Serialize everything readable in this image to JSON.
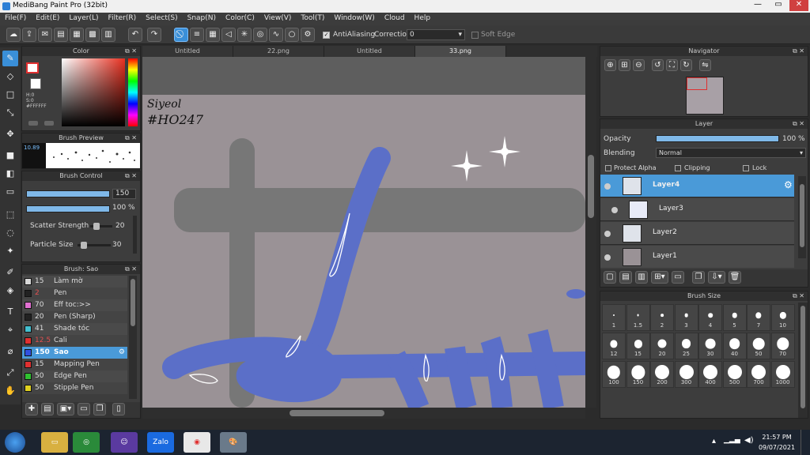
{
  "window": {
    "title": "MediBang Paint Pro (32bit)",
    "min": "—",
    "max": "▭",
    "close": "✕"
  },
  "menu": [
    "File(F)",
    "Edit(E)",
    "Layer(L)",
    "Filter(R)",
    "Select(S)",
    "Snap(N)",
    "Color(C)",
    "View(V)",
    "Tool(T)",
    "Window(W)",
    "Cloud",
    "Help"
  ],
  "toolbar": {
    "antialias_label": "AntiAliasing",
    "correction_label": "Correction",
    "correction_value": "0",
    "soft_edge_label": "Soft Edge"
  },
  "tabs": [
    "Untitled",
    "22.png",
    "Untitled",
    "33.png"
  ],
  "color_panel": {
    "title": "Color",
    "h": "H:0",
    "s": "S:0",
    "hex": "#FFFFFF"
  },
  "brush_preview": {
    "title": "Brush Preview",
    "size": "10.89"
  },
  "brush_control": {
    "title": "Brush Control",
    "size_value": "150",
    "opacity_value": "100 %",
    "scatter_label": "Scatter Strength",
    "scatter_value": "20",
    "particle_label": "Particle Size",
    "particle_value": "30"
  },
  "brush_list": {
    "title": "Brush: Sao",
    "items": [
      {
        "num": "15",
        "name": "Làm mờ",
        "color": "#d8d8d8"
      },
      {
        "num": "2",
        "name": "Pen",
        "color": "#222222"
      },
      {
        "num": "70",
        "name": "Eff toc:>>",
        "color": "#e070d0"
      },
      {
        "num": "20",
        "name": "Pen (Sharp)",
        "color": "#222222"
      },
      {
        "num": "41",
        "name": "Shade tóc",
        "color": "#44c0d0"
      },
      {
        "num": "12.5",
        "name": "Cali",
        "color": "#e03030"
      },
      {
        "num": "150",
        "name": "Sao",
        "color": "#3050e0",
        "selected": true
      },
      {
        "num": "15",
        "name": "Mapping Pen",
        "color": "#e03030"
      },
      {
        "num": "50",
        "name": "Edge Pen",
        "color": "#30c030"
      },
      {
        "num": "50",
        "name": "Stipple Pen",
        "color": "#e0d020"
      }
    ]
  },
  "canvas": {
    "handwriting_line1": "Siyeol",
    "handwriting_line2": "#HO247"
  },
  "navigator": {
    "title": "Navigator"
  },
  "layer_panel": {
    "title": "Layer",
    "opacity_label": "Opacity",
    "opacity_value": "100 %",
    "blending_label": "Blending",
    "blending_value": "Normal",
    "protect_alpha": "Protect Alpha",
    "clipping": "Clipping",
    "lock": "Lock",
    "layers": [
      {
        "name": "Layer4",
        "selected": true
      },
      {
        "name": "Layer3"
      },
      {
        "name": "Layer2"
      },
      {
        "name": "Layer1"
      }
    ]
  },
  "brush_size": {
    "title": "Brush Size",
    "sizes": [
      "1",
      "1.5",
      "2",
      "3",
      "4",
      "5",
      "7",
      "10",
      "12",
      "15",
      "20",
      "25",
      "30",
      "40",
      "50",
      "70",
      "100",
      "150",
      "200",
      "300",
      "400",
      "500",
      "700",
      "1000"
    ]
  },
  "taskbar": {
    "time": "21:57 PM",
    "date": "09/07/2021",
    "zalo": "Zalo"
  }
}
